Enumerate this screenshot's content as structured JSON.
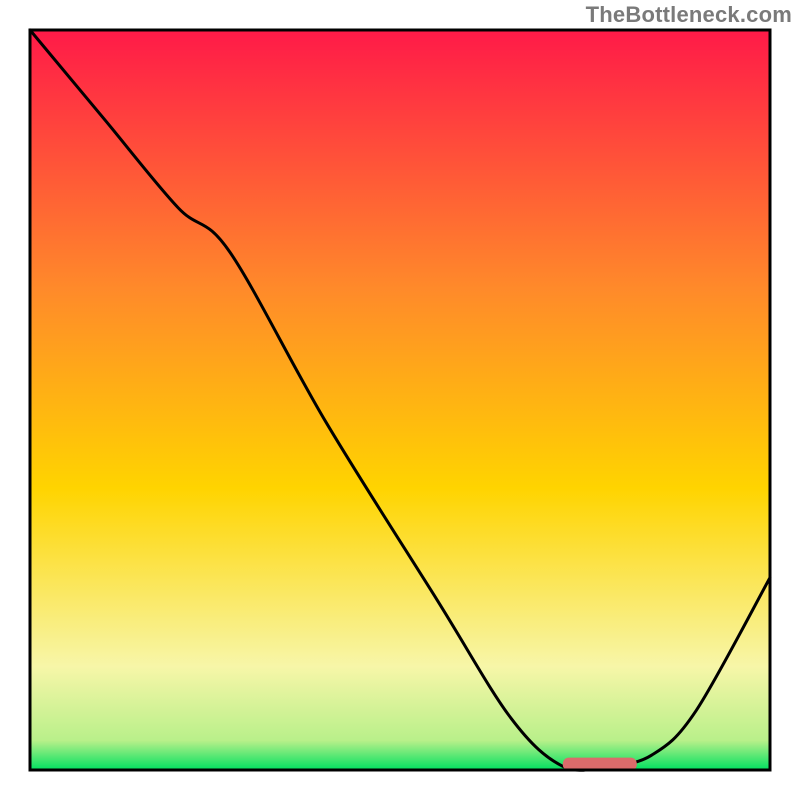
{
  "watermark": "TheBottleneck.com",
  "chart_data": {
    "type": "line",
    "title": "",
    "xlabel": "",
    "ylabel": "",
    "xlim": [
      0,
      100
    ],
    "ylim": [
      0,
      100
    ],
    "background_gradient": {
      "top_color": "#ff1a48",
      "mid_color": "#ffd400",
      "band_color": "#f7f6a8",
      "bottom_color": "#00e060"
    },
    "curve": {
      "name": "bottleneck-curve",
      "x": [
        0.0,
        10,
        20,
        27,
        40,
        55,
        65,
        72,
        78,
        84,
        90,
        100
      ],
      "y": [
        100,
        88,
        76,
        70,
        47,
        23,
        7,
        0.5,
        0.5,
        2,
        8,
        26
      ]
    },
    "marker": {
      "name": "optimal-marker",
      "color": "#db6b6b",
      "shape": "rounded-rect",
      "x_range": [
        72,
        82
      ],
      "y": 0.8
    },
    "plot_frame": {
      "stroke": "#000000",
      "stroke_width": 3
    }
  }
}
